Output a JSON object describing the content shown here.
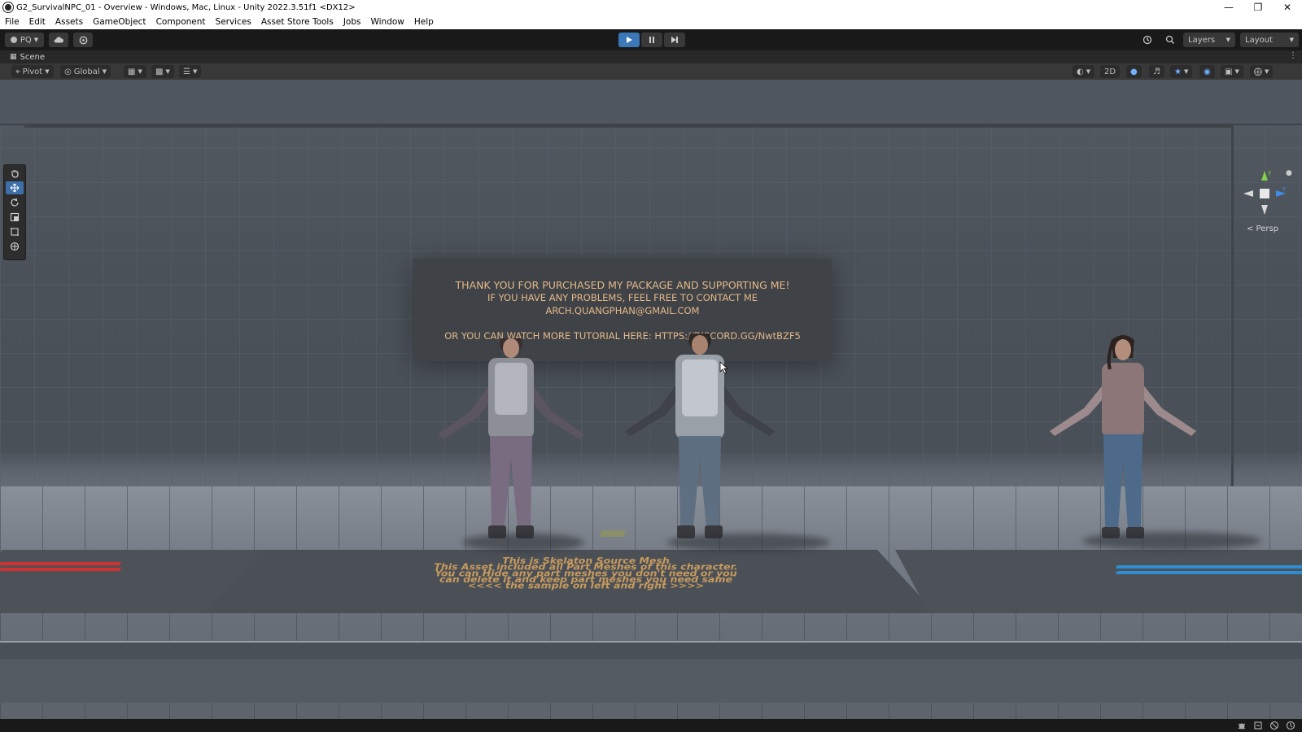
{
  "window": {
    "title": "G2_SurvivalNPC_01 - Overview - Windows, Mac, Linux - Unity 2022.3.51f1 <DX12>",
    "controls": [
      "minimize-icon",
      "restore-icon",
      "close-icon"
    ]
  },
  "menu": {
    "items": [
      "File",
      "Edit",
      "Assets",
      "GameObject",
      "Component",
      "Services",
      "Asset Store Tools",
      "Jobs",
      "Window",
      "Help"
    ]
  },
  "toolbar": {
    "account_label": "PQ",
    "layers_label": "Layers",
    "layout_label": "Layout"
  },
  "scene": {
    "tab_label": "Scene",
    "pivot_label": "Pivot",
    "global_label": "Global",
    "mode_2d_label": "2D",
    "persp_label": "< Persp"
  },
  "sign": {
    "line1": "THANK YOU FOR PURCHASED MY PACKAGE AND SUPPORTING ME!",
    "line2": "IF YOU HAVE ANY PROBLEMS, FEEL FREE TO CONTACT ME",
    "line3": "ARCH.QUANGPHAN@GMAIL.COM",
    "line4": "OR YOU CAN WATCH MORE TUTORIAL HERE: HTTPS://DISCORD.GG/NwtBZF5"
  },
  "plate": {
    "lines": [
      "This is Skelaton Source Mesh",
      "This Asset included all Part Meshes of this character.",
      "You can Hide any part meshes you don't need or you",
      "can delete it and keep part meshes you need same",
      "<<<<  the sample on left and right  >>>>"
    ]
  },
  "colors": {
    "accent_play": "#3a78b8",
    "sign_text": "#e3b88a",
    "plate_text": "#c79a5d",
    "left_plate_text": "#d43030",
    "right_plate_text": "#2c8ed4"
  }
}
